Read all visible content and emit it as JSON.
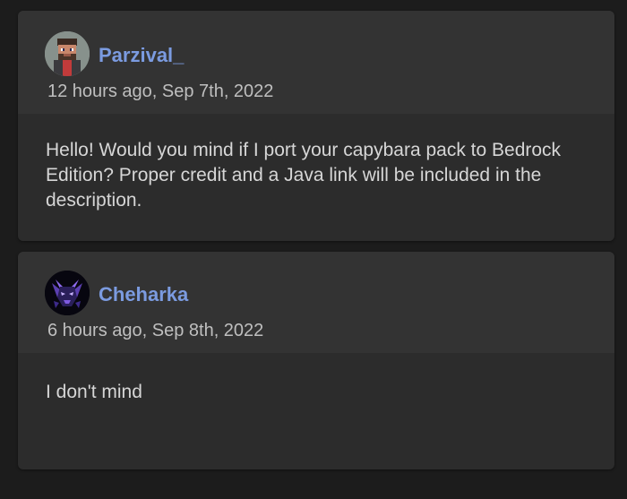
{
  "comments": [
    {
      "username": "Parzival_",
      "avatar_icon": "pixel-character-avatar-icon",
      "timestamp": "12 hours ago, Sep 7th, 2022",
      "message": "Hello! Would you mind if I port your capybara pack to Bedrock Edition? Proper credit and a Java link will be included in the description."
    },
    {
      "username": "Cheharka",
      "avatar_icon": "purple-creature-avatar-icon",
      "timestamp": "6 hours ago, Sep 8th, 2022",
      "message": "I don't mind"
    }
  ],
  "colors": {
    "page_background": "#1c1c1c",
    "card_header": "#333333",
    "card_body": "#2c2c2c",
    "username": "#7b9be0",
    "timestamp": "#bfbfbf",
    "message_text": "#d6d6d6"
  }
}
